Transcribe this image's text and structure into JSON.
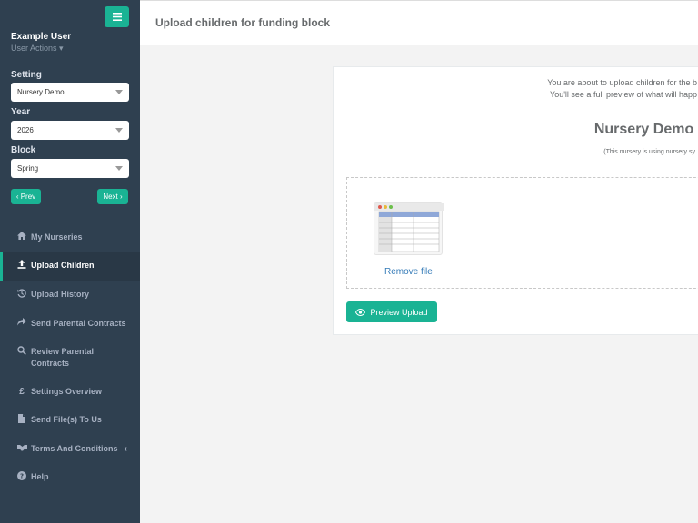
{
  "sidebar": {
    "menu_icon": "hamburger-icon",
    "user_name": "Example User",
    "user_actions": "User Actions ▾",
    "setting": {
      "label": "Setting",
      "value": "Nursery Demo"
    },
    "year": {
      "label": "Year",
      "value": "2026"
    },
    "block": {
      "label": "Block",
      "value": "Spring"
    },
    "prev_label": "‹ Prev",
    "next_label": "Next ›",
    "nav": [
      {
        "label": "My Nurseries",
        "icon": "home-icon"
      },
      {
        "label": "Upload Children",
        "icon": "upload-icon",
        "active": true
      },
      {
        "label": "Upload History",
        "icon": "history-icon"
      },
      {
        "label": "Send Parental Contracts",
        "icon": "share-icon"
      },
      {
        "label": "Review Parental Contracts",
        "icon": "search-icon"
      },
      {
        "label": "Settings Overview",
        "icon": "pound-icon"
      },
      {
        "label": "Send File(s) To Us",
        "icon": "file-icon"
      },
      {
        "label": "Terms And Conditions",
        "icon": "handshake-icon"
      },
      {
        "label": "Help",
        "icon": "help-icon"
      }
    ]
  },
  "header": {
    "title": "Upload children for funding block"
  },
  "main": {
    "info_line1": "You are about to upload children for the b",
    "info_line2": "You'll see a full preview of what will happ",
    "nursery_title": "Nursery Demo -",
    "nursery_note": "(This nursery is using nursery sy",
    "remove_file": "Remove file",
    "preview_button": "Preview Upload"
  },
  "colors": {
    "sidebar": "#2f4050",
    "accent": "#1ab394",
    "link": "#337ab7"
  }
}
